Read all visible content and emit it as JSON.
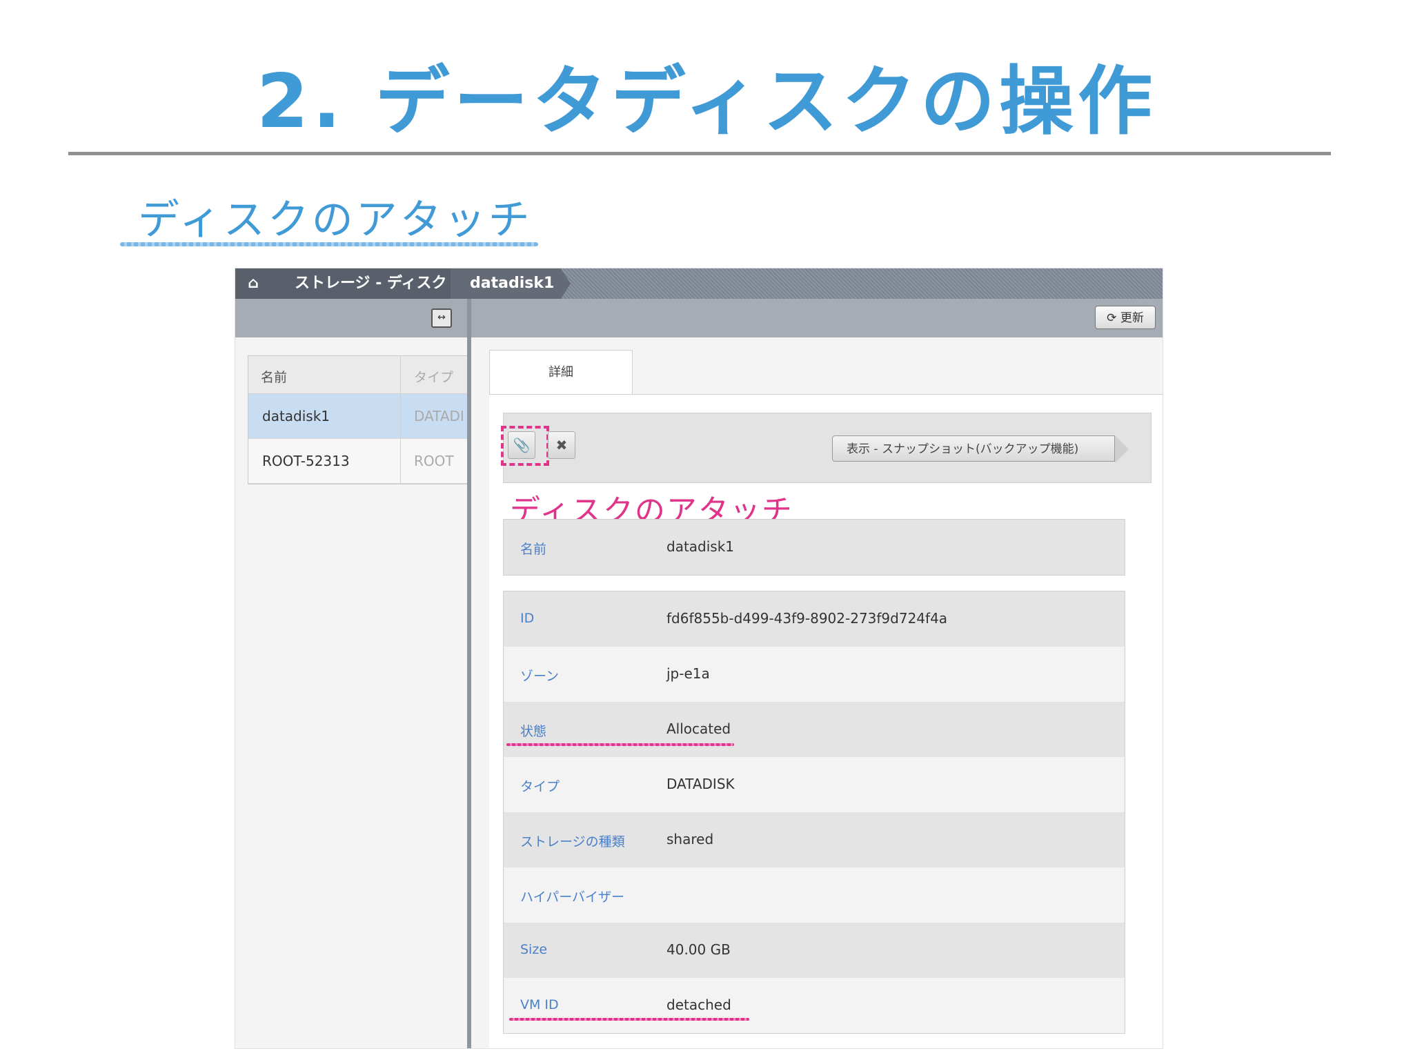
{
  "slide": {
    "title": "2. データディスクの操作",
    "subtitle": "ディスクのアタッチ",
    "annotation": "ディスクのアタッチ"
  },
  "breadcrumb": {
    "home_icon": "home-icon",
    "items": [
      "ストレージ - ディスク",
      "datadisk1"
    ]
  },
  "toolbar": {
    "refresh_label": "更新",
    "refresh_icon": "refresh-icon",
    "collapse_icon": "collapse-icon"
  },
  "list": {
    "columns": [
      "名前",
      "タイプ"
    ],
    "rows": [
      {
        "name": "datadisk1",
        "type": "DATADI",
        "selected": true
      },
      {
        "name": "ROOT-52313",
        "type": "ROOT",
        "selected": false
      }
    ]
  },
  "detail": {
    "tab_label": "詳細",
    "actions": {
      "attach_icon": "attach-disk-icon",
      "delete_icon": "delete-icon",
      "snapshot_label": "表示 - スナップショット(バックアップ機能)"
    },
    "name_row": {
      "label": "名前",
      "value": "datadisk1"
    },
    "fields": [
      {
        "label": "ID",
        "value": "fd6f855b-d499-43f9-8902-273f9d724f4a"
      },
      {
        "label": "ゾーン",
        "value": "jp-e1a"
      },
      {
        "label": "状態",
        "value": "Allocated"
      },
      {
        "label": "タイプ",
        "value": "DATADISK"
      },
      {
        "label": "ストレージの種類",
        "value": "shared"
      },
      {
        "label": "ハイパーバイザー",
        "value": ""
      },
      {
        "label": "Size",
        "value": "40.00 GB"
      },
      {
        "label": "VM ID",
        "value": "detached"
      }
    ]
  },
  "colors": {
    "title_blue": "#3f9ad6",
    "highlight_pink": "#e0338a",
    "label_blue": "#4a7fc9"
  }
}
